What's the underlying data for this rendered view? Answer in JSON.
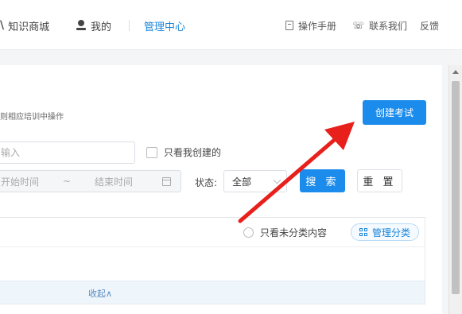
{
  "nav": {
    "logo_glyph": "\\",
    "knowledge_mall": "知识商城",
    "mine": "我的",
    "admin_center": "管理中心",
    "manual": "操作手册",
    "contact": "联系我们",
    "feedback": "反馈"
  },
  "page": {
    "hint_text": "则相应培训中操作",
    "create_exam_button": "创建考试"
  },
  "filters": {
    "search_placeholder": "输入",
    "only_mine_label": "只看我创建的",
    "start_placeholder": "开始时间",
    "range_sep": "~",
    "end_placeholder": "结束时间",
    "status_label": "状态:",
    "status_value": "全部",
    "search_button": "搜 索",
    "reset_button": "重 置"
  },
  "category": {
    "only_uncategorized_label": "只看未分类内容",
    "manage_button": "管理分类",
    "collapse_label": "收起∧"
  },
  "colors": {
    "accent": "#1c8cec",
    "arrow": "#e8201b"
  }
}
